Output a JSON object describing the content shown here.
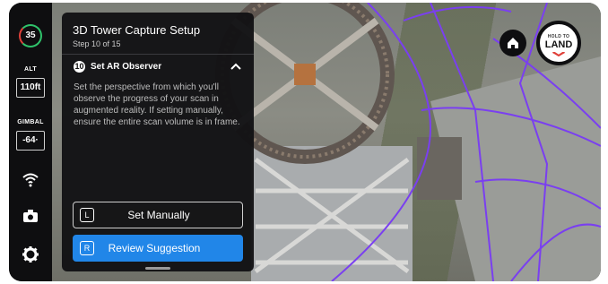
{
  "telemetry": {
    "battery": "35",
    "alt_label": "ALT",
    "alt_value": "110ft",
    "gimbal_label": "GIMBAL",
    "gimbal_value": "-64·"
  },
  "panel": {
    "title": "3D Tower Capture Setup",
    "step": "Step 10 of 15",
    "step_number": "10",
    "step_title": "Set AR Observer",
    "description": "Set the perspective from which you'll observe the progress of your scan in augmented reality. If setting manually, ensure the entire scan volume is in frame.",
    "set_manually": {
      "key": "L",
      "label": "Set Manually"
    },
    "review_suggestion": {
      "key": "R",
      "label": "Review Suggestion"
    }
  },
  "land_button": {
    "small": "HOLD TO",
    "big": "LAND"
  },
  "icons": {
    "rail": [
      "wifi-icon",
      "camera-icon",
      "gear-icon"
    ],
    "home": "home-icon",
    "collapse": "chevron-up-icon"
  },
  "colors": {
    "panel_bg": "#121214",
    "primary": "#2186e8",
    "battery_ok": "#2fc36b",
    "battery_low": "#e0413a",
    "overlay_lines": "#7a3ff0"
  }
}
